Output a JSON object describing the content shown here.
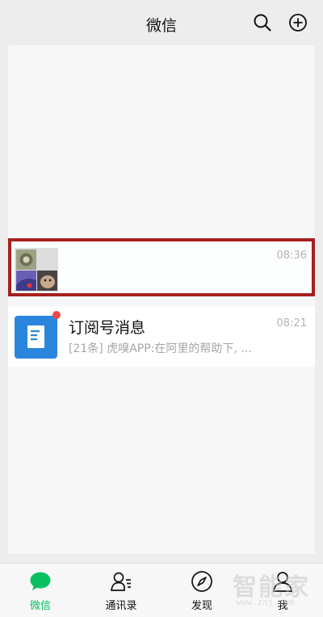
{
  "header": {
    "title": "微信",
    "search_icon": "search-icon",
    "add_icon": "plus-circle-icon"
  },
  "chats": [
    {
      "name": "",
      "preview": "",
      "time": "08:36",
      "avatar": "group-avatar-grid",
      "highlighted": true
    },
    {
      "name": "订阅号消息",
      "preview": "[21条] 虎嗅APP:在阿里的帮助下, ...",
      "time": "08:21",
      "avatar": "subscription-document-icon",
      "unread_dot": true
    }
  ],
  "tabbar": {
    "tabs": [
      {
        "label": "微信",
        "icon": "chat-bubble-icon",
        "active": true
      },
      {
        "label": "通讯录",
        "icon": "contacts-icon",
        "active": false
      },
      {
        "label": "发现",
        "icon": "compass-icon",
        "active": false
      },
      {
        "label": "我",
        "icon": "person-icon",
        "active": false
      }
    ]
  },
  "watermark": {
    "big": "智能家",
    "small": "www.znj.com"
  },
  "colors": {
    "accent": "#07c160",
    "highlight_border": "#a5211f",
    "unread_dot": "#f04848",
    "subscription_avatar": "#2a86dd"
  }
}
